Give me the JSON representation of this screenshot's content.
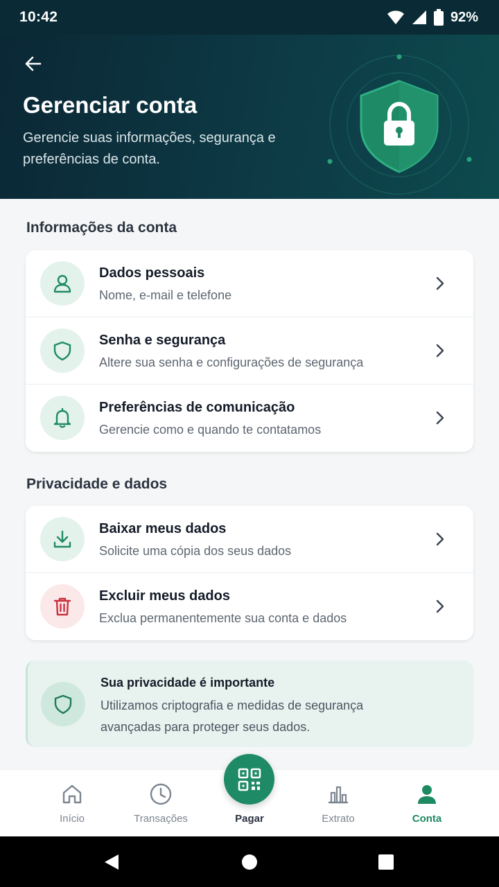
{
  "status_bar": {
    "time": "10:42",
    "battery": "92%",
    "icons": [
      "wifi-icon",
      "signal-icon",
      "battery-icon"
    ]
  },
  "header": {
    "title": "Gerenciar conta",
    "subtitle": "Gerencie suas informações, segurança e preferências de conta.",
    "back_icon": "arrow-left-icon",
    "hero_icon": "shield-lock-icon"
  },
  "sections": {
    "account": {
      "title": "Informações da conta",
      "items": [
        {
          "title": "Dados pessoais",
          "subtitle": "Nome, e-mail e telefone",
          "icon": "user-icon"
        },
        {
          "title": "Senha e segurança",
          "subtitle": "Altere sua senha e configurações de segurança",
          "icon": "shield-icon"
        },
        {
          "title": "Preferências de comunicação",
          "subtitle": "Gerencie como e quando te contatamos",
          "icon": "bell-icon"
        }
      ]
    },
    "privacy": {
      "title": "Privacidade e dados",
      "items": [
        {
          "title": "Baixar meus dados",
          "subtitle": "Solicite uma cópia dos seus dados",
          "icon": "download-icon"
        },
        {
          "title": "Excluir meus dados",
          "subtitle": "Exclua permanentemente sua conta e dados",
          "icon": "trash-icon"
        }
      ]
    }
  },
  "privacy_notice": {
    "title": "Sua privacidade é importante",
    "text": "Utilizamos criptografia e medidas de segurança avançadas para proteger seus dados.",
    "icon": "shield-icon"
  },
  "bottom_nav": {
    "items": [
      {
        "label": "Início",
        "icon": "home-icon"
      },
      {
        "label": "Transações",
        "icon": "clock-icon"
      },
      {
        "label": "Pagar",
        "icon": "qr-code-icon"
      },
      {
        "label": "Extrato",
        "icon": "bar-chart-icon"
      },
      {
        "label": "Conta",
        "icon": "user-icon"
      }
    ],
    "active": "Conta"
  },
  "colors": {
    "header_dark": "#0b2735",
    "accent_green": "#1f8a66",
    "icon_bg_green": "#e4f2ec",
    "danger_red": "#c9303c",
    "danger_bg": "#fbe9ea",
    "notice_bg": "#e8f3ef"
  }
}
